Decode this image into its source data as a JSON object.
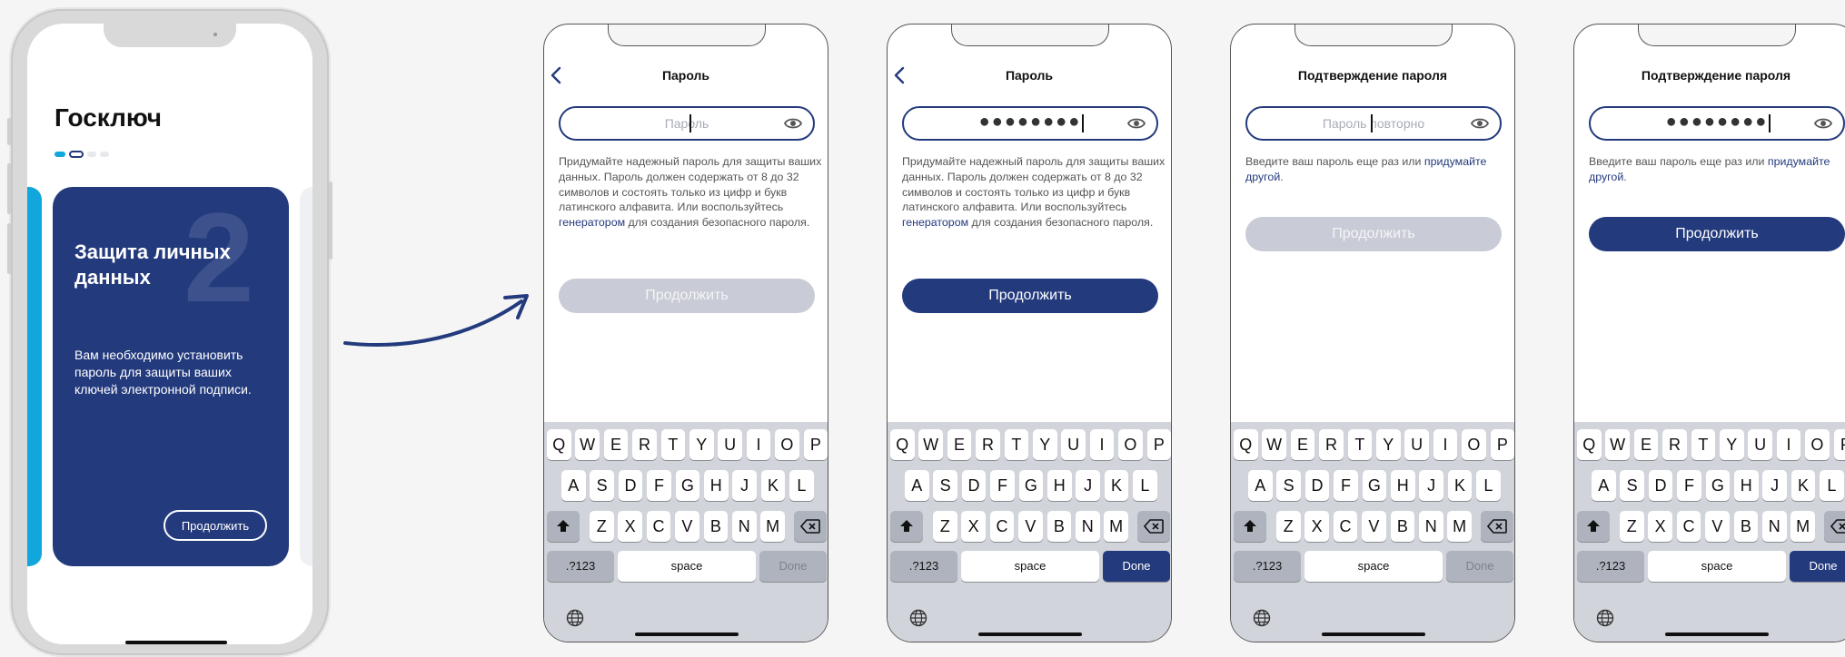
{
  "mockup": {
    "app_title": "Госключ",
    "card": {
      "number": "2",
      "title": "Защита личных данных",
      "text": "Вам необходимо установить пароль для защиты ваших ключей электронной подписи.",
      "button": "Продолжить"
    },
    "pagination": {
      "total": 4,
      "active_index": 1
    }
  },
  "screens": [
    {
      "title": "Пароль",
      "has_back": true,
      "placeholder": "Пароль",
      "value": "",
      "description": {
        "before": "Придумайте надежный пароль для защиты ваших данных. Пароль должен содержать от 8 до 32 символов и состоять только из цифр и букв латинского алфавита. Или воспользуйтесь ",
        "link": "генератором",
        "after": " для создания безопасного пароля."
      },
      "button": "Продолжить",
      "button_enabled": false
    },
    {
      "title": "Пароль",
      "has_back": true,
      "placeholder": "Пароль",
      "value": "●●●●●●●●",
      "description": {
        "before": "Придумайте надежный пароль для защиты ваших данных. Пароль должен содержать от 8 до 32 символов и состоять только из цифр и букв латинского алфавита. Или воспользуйтесь ",
        "link": "генератором",
        "after": " для создания безопасного пароля."
      },
      "button": "Продолжить",
      "button_enabled": true
    },
    {
      "title": "Подтверждение пароля",
      "has_back": false,
      "placeholder": "Пароль повторно",
      "value": "",
      "description": {
        "before": "Введите ваш пароль еще раз или ",
        "link": "придумайте другой",
        "after": "."
      },
      "button": "Продолжить",
      "button_enabled": false
    },
    {
      "title": "Подтверждение пароля",
      "has_back": false,
      "placeholder": "Пароль повторно",
      "value": "●●●●●●●●",
      "description": {
        "before": "Введите ваш пароль еще раз или ",
        "link": "придумайте другой",
        "after": "."
      },
      "button": "Продолжить",
      "button_enabled": true
    }
  ],
  "keyboard": {
    "row1": [
      "Q",
      "W",
      "E",
      "R",
      "T",
      "Y",
      "U",
      "I",
      "O",
      "P"
    ],
    "row2": [
      "A",
      "S",
      "D",
      "F",
      "G",
      "H",
      "J",
      "K",
      "L"
    ],
    "row3": [
      "Z",
      "X",
      "C",
      "V",
      "B",
      "N",
      "M"
    ],
    "numbers": ".?123",
    "space": "space",
    "done": "Done"
  },
  "colors": {
    "brand_blue": "#233a7d",
    "accent_cyan": "#12a7dc",
    "disabled_button": "#c9ccd6",
    "keyboard_bg": "#d1d4db"
  }
}
